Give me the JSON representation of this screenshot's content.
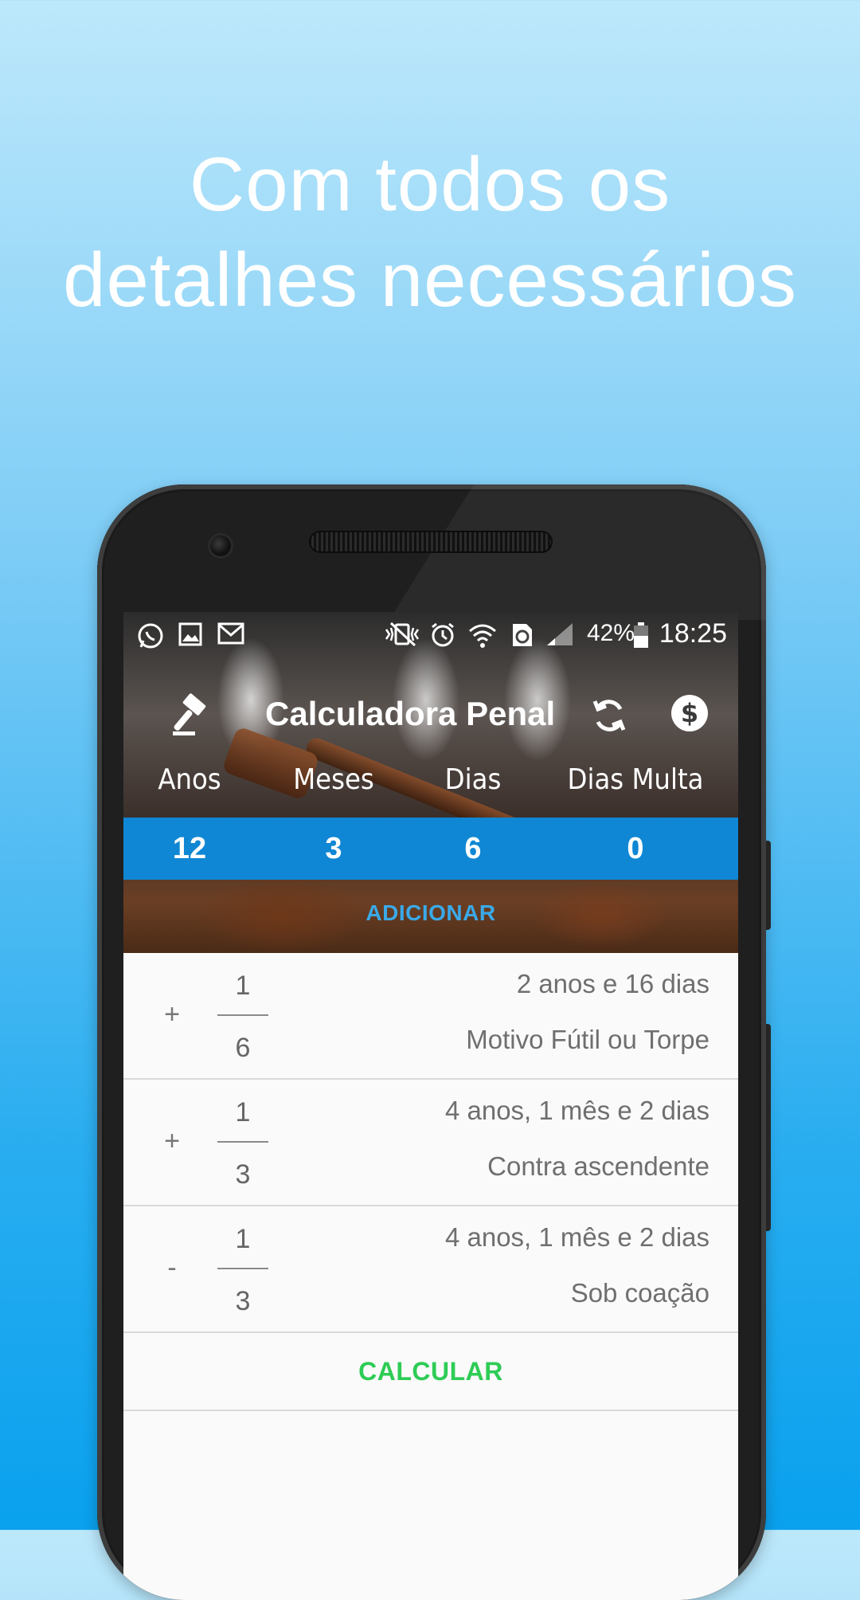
{
  "headline": {
    "line1": "Com todos os",
    "line2": "detalhes necessários"
  },
  "statusbar": {
    "left_icons": [
      "whatsapp-icon",
      "image-icon",
      "gmail-icon"
    ],
    "right_icons": [
      "vibrate-icon",
      "alarm-icon",
      "wifi-icon",
      "data-saver-icon",
      "signal-icon",
      "battery-icon"
    ],
    "battery": "42%",
    "time": "18:25"
  },
  "toolbar": {
    "title": "Calculadora Penal",
    "left_icon": "gavel-icon",
    "refresh_icon": "refresh-icon",
    "money_icon": "dollar-icon"
  },
  "columns": {
    "labels": [
      "Anos",
      "Meses",
      "Dias",
      "Dias Multa"
    ],
    "values": [
      "12",
      "3",
      "6",
      "0"
    ]
  },
  "adicionar_label": "ADICIONAR",
  "rows": [
    {
      "sign": "+",
      "numerator": "1",
      "denominator": "6",
      "duration": "2 anos e 16 dias",
      "description": "Motivo Fútil ou Torpe"
    },
    {
      "sign": "+",
      "numerator": "1",
      "denominator": "3",
      "duration": "4 anos, 1 mês e 2 dias",
      "description": "Contra ascendente"
    },
    {
      "sign": "-",
      "numerator": "1",
      "denominator": "3",
      "duration": "4 anos, 1 mês e 2 dias",
      "description": "Sob coação"
    }
  ],
  "calcular_label": "CALCULAR",
  "colors": {
    "values_bar": "#0f87d4",
    "adicionar": "#3aa9e8",
    "calcular": "#2ecc55"
  }
}
